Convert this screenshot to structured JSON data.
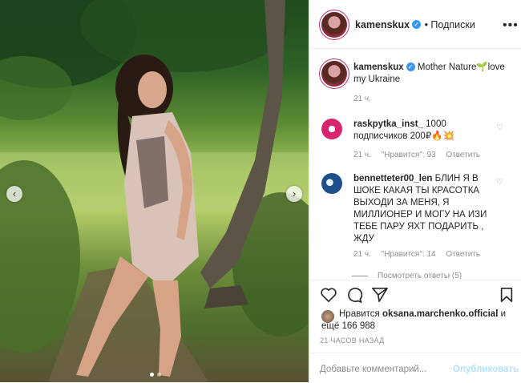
{
  "post": {
    "username": "kamenskux",
    "follow_label": "• Подписки",
    "caption_text": "Mother Nature🌱love my Ukraine",
    "caption_time": "21 ч."
  },
  "comments": [
    {
      "username": "raskpytka_inst_",
      "text": "1000 подписчиков 200₽🔥💥",
      "time": "21 ч.",
      "likes": "\"Нравится\": 93",
      "reply_label": "Ответить"
    },
    {
      "username": "bennetteter00_len",
      "text": "БЛИН Я В ШОКЕ КАКАЯ ТЫ КРАСОТКА ВЫХОДИ ЗА МЕНЯ, Я МИЛЛИОНЕР И МОГУ НА ИЗИ ТЕБЕ ПАРУ ЯХТ ПОДАРИТЬ , ЖДУ",
      "time": "21 ч.",
      "likes": "\"Нравится\": 14",
      "reply_label": "Ответить"
    }
  ],
  "more_replies": "Посмотреть ответы (5)",
  "likes": {
    "prefix": "Нравится",
    "user": "oksana.marchenko.official",
    "suffix": "и ещё 166 988"
  },
  "post_date": "21 ЧАСОВ НАЗАД",
  "add_comment": {
    "placeholder": "Добавьте комментарий...",
    "publish_label": "Опубликовать"
  },
  "colors": {
    "verified": "#3897f0",
    "publish_disabled": "#b2dffc",
    "secondary_text": "#8e8e8e"
  }
}
